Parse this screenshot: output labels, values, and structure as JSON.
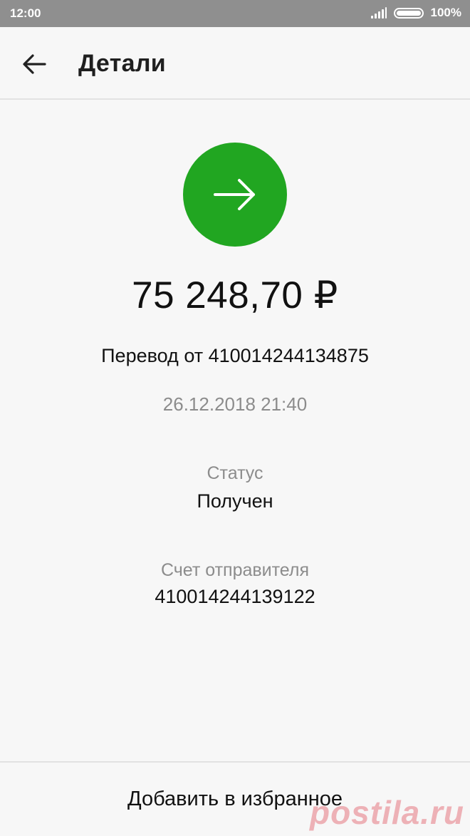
{
  "status_bar": {
    "time": "12:00",
    "battery": "100%"
  },
  "app_bar": {
    "title": "Детали",
    "back_icon": "arrow-left-icon"
  },
  "transaction": {
    "direction_icon": "arrow-right-icon",
    "direction_color": "#21a621",
    "amount": "75 248,70 ₽",
    "description": "Перевод от 410014244134875",
    "datetime": "26.12.2018 21:40",
    "status_label": "Статус",
    "status_value": "Получен",
    "sender_label": "Счет отправителя",
    "sender_value": "410014244139122"
  },
  "actions": {
    "favorite_label": "Добавить в избранное"
  },
  "watermark": "postila.ru"
}
